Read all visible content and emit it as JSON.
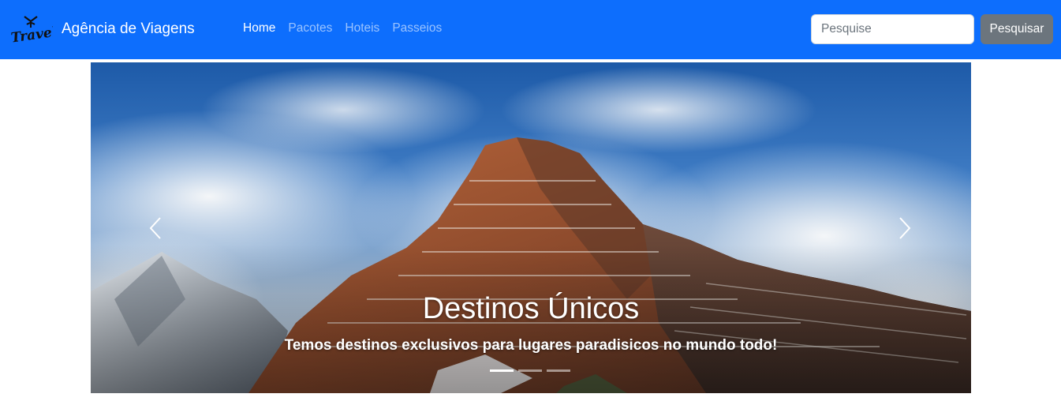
{
  "brand": {
    "logo_text": "Travel",
    "name": "Agência de Viagens"
  },
  "nav": {
    "items": [
      {
        "label": "Home",
        "active": true
      },
      {
        "label": "Pacotes",
        "active": false
      },
      {
        "label": "Hoteis",
        "active": false
      },
      {
        "label": "Passeios",
        "active": false
      }
    ]
  },
  "search": {
    "placeholder": "Pesquise",
    "value": "",
    "button_label": "Pesquisar"
  },
  "carousel": {
    "slide_title": "Destinos Únicos",
    "slide_text": "Temos destinos exclusivos para lugares paradisicos no mundo todo!",
    "slide_count": 3,
    "active_index": 0,
    "controls": {
      "prev_icon": "chevron-left-icon",
      "next_icon": "chevron-right-icon"
    }
  },
  "colors": {
    "navbar_bg": "#0d6efd",
    "button_bg": "#6c757d",
    "text_light": "#ffffff"
  }
}
